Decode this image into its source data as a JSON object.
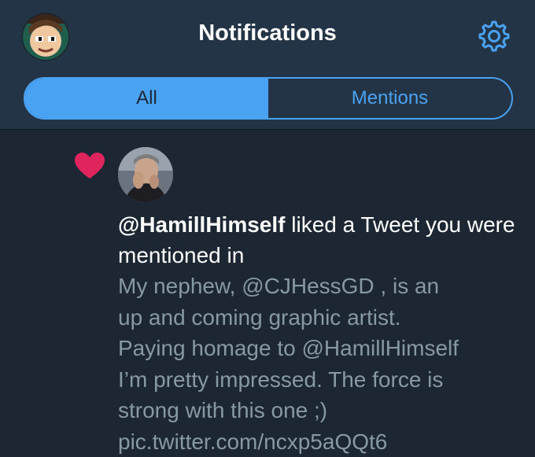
{
  "header": {
    "title": "Notifications",
    "settings_icon": "gear-icon",
    "avatar_icon": "profile-avatar"
  },
  "tabs": [
    {
      "label": "All",
      "active": true
    },
    {
      "label": "Mentions",
      "active": false
    }
  ],
  "notification": {
    "type_icon": "heart-icon",
    "user_handle": "@HamillHimself",
    "action_text": " liked a Tweet you were mentioned in",
    "tweet_lines": [
      "My nephew, @CJHessGD , is an",
      "up and coming graphic artist.",
      "Paying homage to @HamillHimself",
      "I’m pretty impressed.  The force is",
      "strong with this one ;)",
      "pic.twitter.com/ncxp5aQQt6"
    ]
  },
  "colors": {
    "background": "#1c2733",
    "header": "#243447",
    "accent": "#4aa3f2",
    "heart": "#e0245e",
    "muted_text": "#8899a6"
  }
}
